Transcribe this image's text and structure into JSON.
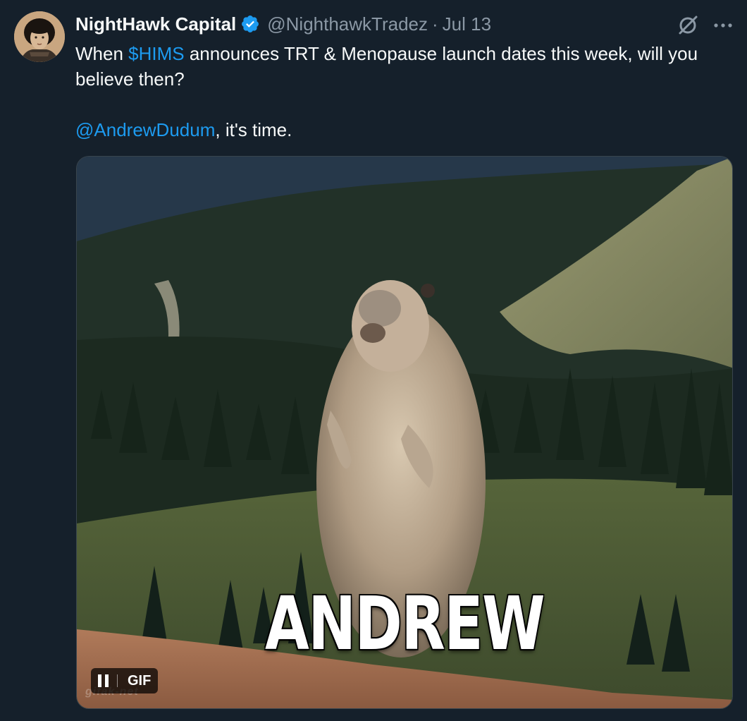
{
  "tweet": {
    "author": {
      "display_name": "NightHawk Capital",
      "handle": "@NighthawkTradez",
      "verified": true,
      "separator": "·",
      "timestamp": "Jul 13"
    },
    "text": {
      "line1_prefix": "When ",
      "cashtag": "$HIMS",
      "line1_suffix": " announces TRT & Menopause launch dates this week, will you believe then?",
      "mention": "@AndrewDudum",
      "line2_suffix": ", it's time."
    },
    "media": {
      "type": "GIF",
      "caption": "ANDREW",
      "watermark": "gifak-net",
      "gif_badge_label": "GIF",
      "playing": true
    },
    "icons": {
      "grok": "grok-icon",
      "more": "more-options-icon",
      "verified": "verified-badge-icon",
      "pause": "pause-icon"
    },
    "colors": {
      "background": "#15202b",
      "text_primary": "#f7f9f9",
      "text_secondary": "#8b98a5",
      "link": "#1d9bf0",
      "verified_badge": "#1d9bf0"
    }
  }
}
